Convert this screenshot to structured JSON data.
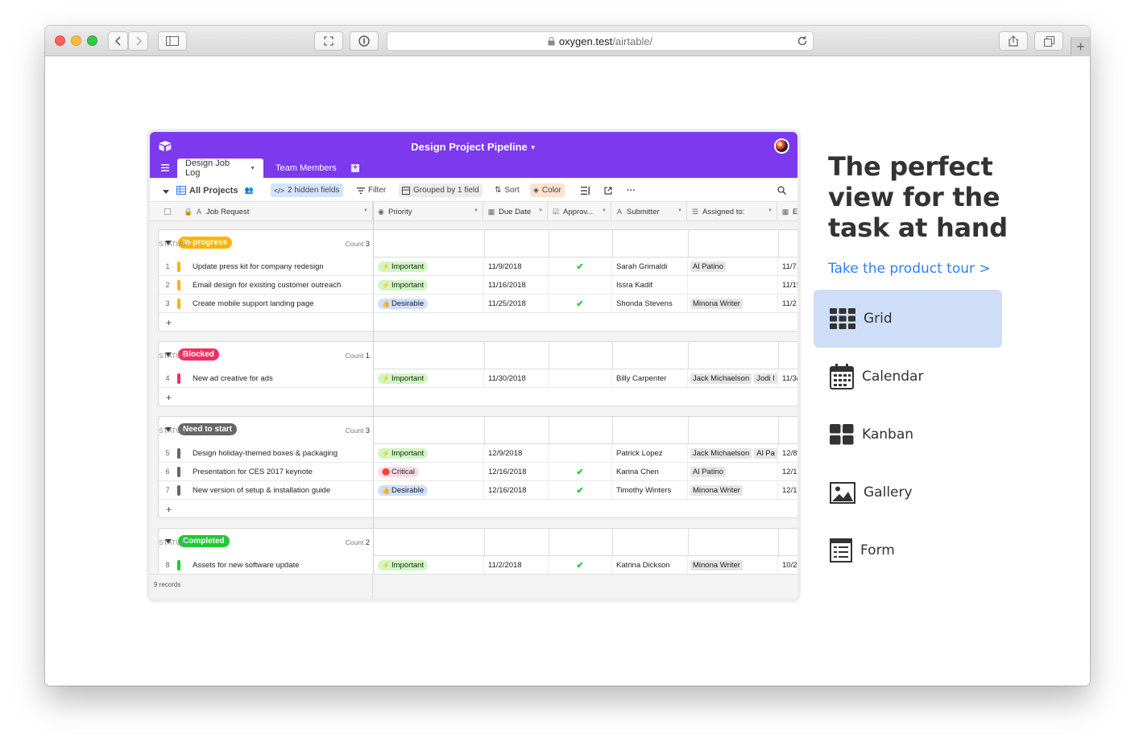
{
  "browser": {
    "url_host": "oxygen.test",
    "url_path": "/airtable/"
  },
  "app": {
    "base_name": "Design Project Pipeline",
    "tabs": [
      "Design Job Log",
      "Team Members"
    ],
    "toolbar": {
      "view_name": "All Projects",
      "hidden_fields": "2 hidden fields",
      "filter": "Filter",
      "grouped": "Grouped by 1 field",
      "sort": "Sort",
      "color": "Color"
    },
    "columns": [
      "Job Request",
      "Priority",
      "Due Date",
      "Approv...",
      "Submitter",
      "Assigned to:",
      "E"
    ],
    "groups": [
      {
        "status": "In-progress",
        "status_label": "STATUS",
        "count_label": "Count",
        "count": "3",
        "color": "#fcb400",
        "rows": [
          {
            "num": "1",
            "job": "Update press kit for company redesign",
            "priority": "Important",
            "priority_type": "imp",
            "due": "11/9/2018",
            "approved": true,
            "submitter": "Sarah Grimaldi",
            "assigned": [
              "Al Patino"
            ],
            "extra": "11/7,"
          },
          {
            "num": "2",
            "job": "Email design for existing customer outreach",
            "priority": "Important",
            "priority_type": "imp",
            "due": "11/16/2018",
            "approved": false,
            "submitter": "Issra Kadif",
            "assigned": [],
            "extra": "11/1!"
          },
          {
            "num": "3",
            "job": "Create mobile support landing page",
            "priority": "Desirable",
            "priority_type": "des",
            "due": "11/25/2018",
            "approved": true,
            "submitter": "Shonda Stevens",
            "assigned": [
              "Minona Writer"
            ],
            "extra": "11/2"
          }
        ]
      },
      {
        "status": "Blocked",
        "status_label": "STATUS",
        "count_label": "Count",
        "count": "1",
        "color": "#f82b60",
        "rows": [
          {
            "num": "4",
            "job": "New ad creative for ads",
            "priority": "Important",
            "priority_type": "imp",
            "due": "11/30/2018",
            "approved": false,
            "submitter": "Billy Carpenter",
            "assigned": [
              "Jack Michaelson",
              "Jodi I"
            ],
            "extra": "11/3("
          }
        ]
      },
      {
        "status": "Need to start",
        "status_label": "STATUS",
        "count_label": "Count",
        "count": "3",
        "color": "#666666",
        "rows": [
          {
            "num": "5",
            "job": "Design holiday-themed boxes & packaging",
            "priority": "Important",
            "priority_type": "imp",
            "due": "12/9/2018",
            "approved": false,
            "submitter": "Patrick Lopez",
            "assigned": [
              "Jack Michaelson",
              "Al Pa"
            ],
            "extra": "12/8"
          },
          {
            "num": "6",
            "job": "Presentation for CES 2017 keynote",
            "priority": "Critical",
            "priority_type": "crit",
            "due": "12/16/2018",
            "approved": true,
            "submitter": "Karina Chen",
            "assigned": [
              "Al Patino"
            ],
            "extra": "12/1:"
          },
          {
            "num": "7",
            "job": "New version of setup & installation guide",
            "priority": "Desirable",
            "priority_type": "des",
            "due": "12/16/2018",
            "approved": true,
            "submitter": "Timothy Winters",
            "assigned": [
              "Minona Writer"
            ],
            "extra": "12/1:"
          }
        ]
      },
      {
        "status": "Completed",
        "status_label": "STATUS",
        "count_label": "Count",
        "count": "2",
        "color": "#20c933",
        "rows": [
          {
            "num": "8",
            "job": "Assets for new software update",
            "priority": "Important",
            "priority_type": "imp",
            "due": "11/2/2018",
            "approved": true,
            "submitter": "Katrina Dickson",
            "assigned": [
              "Minona Writer"
            ],
            "extra": "10/2"
          }
        ]
      }
    ],
    "add_row": "+",
    "records": "9 records"
  },
  "marketing": {
    "headline_lines": [
      "The perfect",
      "view for the",
      "task at hand"
    ],
    "tour_link": "Take the product tour >",
    "views": [
      {
        "label": "Grid",
        "icon": "grid-icon",
        "active": true
      },
      {
        "label": "Calendar",
        "icon": "calendar-icon",
        "active": false
      },
      {
        "label": "Kanban",
        "icon": "kanban-icon",
        "active": false
      },
      {
        "label": "Gallery",
        "icon": "gallery-icon",
        "active": false
      },
      {
        "label": "Form",
        "icon": "form-icon",
        "active": false
      }
    ]
  }
}
